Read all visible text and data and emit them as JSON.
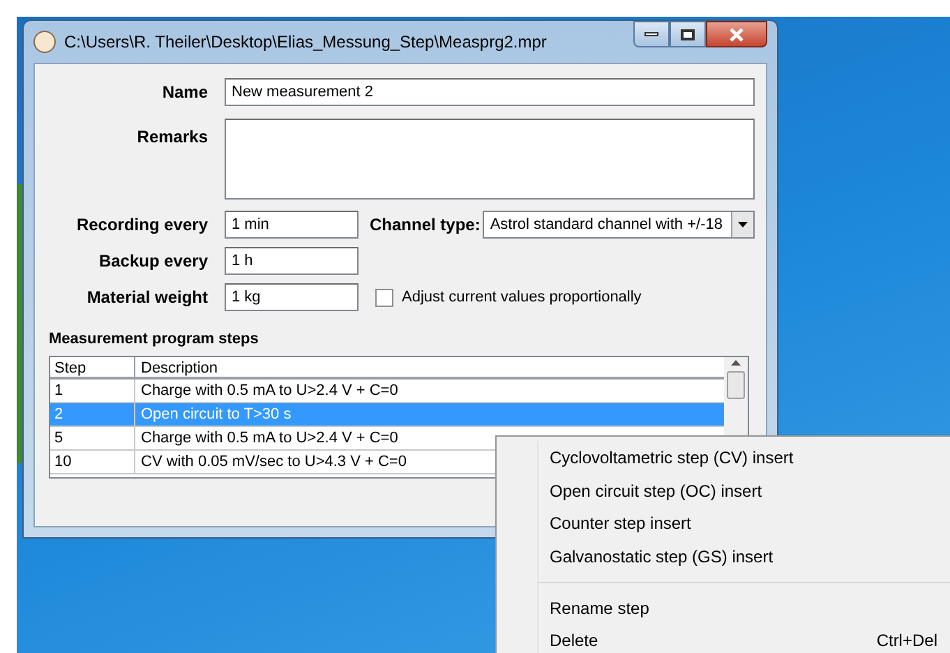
{
  "window": {
    "title": "C:\\Users\\R. Theiler\\Desktop\\Elias_Messung_Step\\Measprg2.mpr"
  },
  "form": {
    "name": {
      "label": "Name",
      "value": "New measurement 2"
    },
    "remarks": {
      "label": "Remarks"
    },
    "recording_every": {
      "label": "Recording every",
      "value": "1 min"
    },
    "channel_type": {
      "label": "Channel type:",
      "value": "Astrol standard channel with +/-18"
    },
    "backup_every": {
      "label": "Backup every",
      "value": "1 h"
    },
    "material_weight": {
      "label": "Material weight",
      "value": "1 kg"
    },
    "adjust_checkbox": {
      "label": "Adjust current values proportionally",
      "checked": false
    }
  },
  "steps": {
    "title": "Measurement program steps",
    "columns": [
      "Step",
      "Description"
    ],
    "rows": [
      {
        "step": "1",
        "description": "Charge with 0.5 mA to U>2.4 V + C=0",
        "selected": false
      },
      {
        "step": "2",
        "description": "Open circuit to T>30 s",
        "selected": true
      },
      {
        "step": "5",
        "description": "Charge with 0.5 mA to U>2.4 V + C=0",
        "selected": false
      },
      {
        "step": "10",
        "description": "CV with 0.05 mV/sec to U>4.3 V + C=0",
        "selected": false
      }
    ]
  },
  "context_menu": {
    "items": [
      {
        "kind": "item",
        "label": "Cyclovoltametric step (CV) insert"
      },
      {
        "kind": "item",
        "label": "Open circuit step (OC) insert"
      },
      {
        "kind": "item",
        "label": "Counter step insert"
      },
      {
        "kind": "item",
        "label": "Galvanostatic step (GS) insert"
      },
      {
        "kind": "separator"
      },
      {
        "kind": "item",
        "label": "Rename step"
      },
      {
        "kind": "item",
        "label": "Delete",
        "shortcut": "Ctrl+Del"
      }
    ]
  }
}
